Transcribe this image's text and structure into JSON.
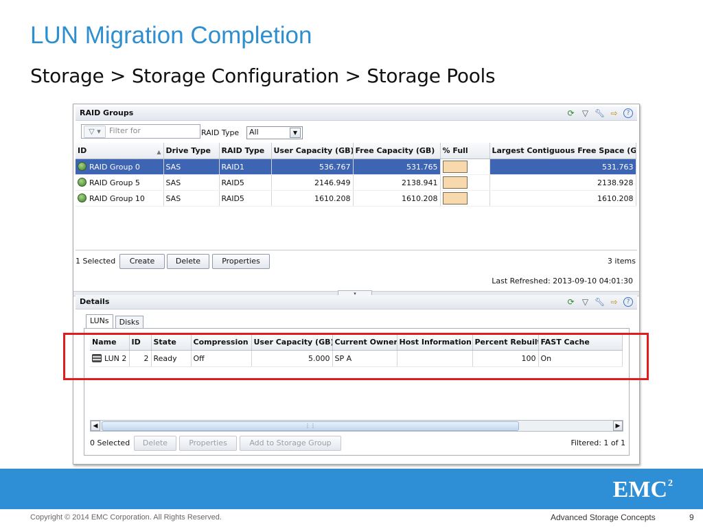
{
  "slide": {
    "title": "LUN Migration Completion",
    "subtitle": "Storage > Storage Configuration > Storage Pools"
  },
  "raid_panel": {
    "title": "RAID Groups",
    "filter_placeholder": "Filter for",
    "raid_type_label": "RAID Type",
    "raid_type_value": "All",
    "columns": [
      "ID",
      "Drive Type",
      "RAID Type",
      "User Capacity (GB)",
      "Free Capacity (GB)",
      "% Full",
      "Largest Contiguous Free Space (GB)"
    ],
    "rows": [
      {
        "id": "RAID Group 0",
        "drive_type": "SAS",
        "raid_type": "RAID1",
        "user_capacity": "536.767",
        "free_capacity": "531.765",
        "largest_free": "531.763",
        "selected": true
      },
      {
        "id": "RAID Group 5",
        "drive_type": "SAS",
        "raid_type": "RAID5",
        "user_capacity": "2146.949",
        "free_capacity": "2138.941",
        "largest_free": "2138.928",
        "selected": false
      },
      {
        "id": "RAID Group 10",
        "drive_type": "SAS",
        "raid_type": "RAID5",
        "user_capacity": "1610.208",
        "free_capacity": "1610.208",
        "largest_free": "1610.208",
        "selected": false
      }
    ],
    "selected_text": "1 Selected",
    "create_label": "Create",
    "delete_label": "Delete",
    "properties_label": "Properties",
    "items_text": "3 items",
    "last_refreshed": "Last Refreshed: 2013-09-10 04:01:30"
  },
  "details_panel": {
    "title": "Details",
    "tabs": [
      "LUNs",
      "Disks"
    ],
    "columns": [
      "Name",
      "ID",
      "State",
      "Compression",
      "User Capacity (GB)",
      "Current Owner",
      "Host Information",
      "Percent Rebuilt",
      "FAST Cache"
    ],
    "rows": [
      {
        "name": "LUN 2",
        "id": "2",
        "state": "Ready",
        "compression": "Off",
        "user_capacity": "5.000",
        "current_owner": "SP A",
        "host_information": "",
        "percent_rebuilt": "100",
        "fast_cache": "On"
      }
    ],
    "selected_text": "0 Selected",
    "delete_label": "Delete",
    "properties_label": "Properties",
    "add_to_sg_label": "Add to Storage Group",
    "filtered_text": "Filtered: 1 of 1"
  },
  "footer": {
    "logo": "EMC",
    "logo_sup": "2",
    "copyright": "Copyright © 2014 EMC Corporation. All Rights Reserved.",
    "course": "Advanced Storage Concepts",
    "page_number": "9"
  },
  "colors": {
    "title_blue": "#2e8fd0",
    "band_blue": "#2e8fd6",
    "selection_blue": "#3e65b3",
    "highlight_red": "#e21b1b"
  },
  "icons": [
    "refresh-icon",
    "filter-icon",
    "wrench-icon",
    "export-icon",
    "help-icon",
    "raid-group-icon",
    "lun-icon"
  ]
}
